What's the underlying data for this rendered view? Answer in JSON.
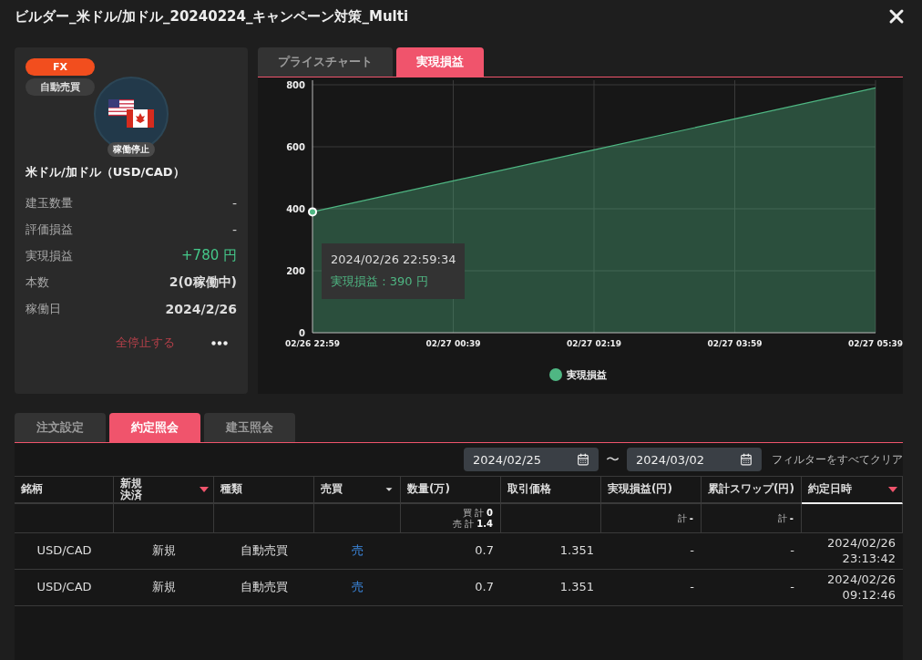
{
  "window": {
    "title": "ビルダー_米ドル/加ドル_20240224_キャンペーン対策_Multi"
  },
  "bot": {
    "badges": [
      {
        "label": "FX",
        "kind": "category"
      },
      {
        "label": "自動売買",
        "kind": "type"
      }
    ],
    "status": "稼働停止",
    "pair": "米ドル/加ドル（USD/CAD）",
    "stats": [
      {
        "label": "建玉数量",
        "value": "-",
        "kind": "plain"
      },
      {
        "label": "評価損益",
        "value": "-",
        "kind": "plain"
      },
      {
        "label": "実現損益",
        "value": "+780 円",
        "kind": "profit"
      },
      {
        "label": "本数",
        "value": "2(0稼働中)",
        "kind": "strong"
      },
      {
        "label": "稼働日",
        "value": "2024/2/26",
        "kind": "strong"
      }
    ],
    "stop_button": "全停止する"
  },
  "chart_tabs": [
    {
      "label": "プライスチャート",
      "selected": false
    },
    {
      "label": "実現損益",
      "selected": true
    }
  ],
  "chart": {
    "chart_data": {
      "type": "area",
      "categories": [
        "02/26 22:59",
        "02/27 00:39",
        "02/27 02:19",
        "02/27 03:59",
        "02/27 05:39"
      ],
      "series": [
        {
          "name": "実現損益",
          "color": "#4fb783",
          "values": [
            390,
            490,
            590,
            690,
            790
          ]
        }
      ],
      "ylim": [
        0,
        800
      ],
      "grid": true,
      "yticks": [
        0,
        200,
        400,
        600,
        800
      ]
    },
    "tooltip": {
      "time": "2024/02/26 22:59:34",
      "label": "実現損益 : 390 円"
    }
  },
  "tabs": [
    {
      "label": "注文設定",
      "selected": false
    },
    {
      "label": "約定照会",
      "selected": true
    },
    {
      "label": "建玉照会",
      "selected": false
    }
  ],
  "filter": {
    "date_from": "2024/02/25",
    "separator": "〜",
    "date_to": "2024/03/02",
    "clear": "フィルターをすべてクリア"
  },
  "table": {
    "columns": [
      {
        "label": "銘柄",
        "sorted": false,
        "filter": false,
        "selected": false
      },
      {
        "label": "新規決済",
        "sorted": true,
        "filter": false,
        "selected": false
      },
      {
        "label": "種類",
        "sorted": false,
        "filter": false,
        "selected": false
      },
      {
        "label": "売買",
        "sorted": false,
        "filter": true,
        "selected": false
      },
      {
        "label": "数量(万)",
        "sorted": false,
        "filter": false,
        "selected": false,
        "summary": [
          "買 計 **0**",
          "売 計 **1.4**"
        ]
      },
      {
        "label": "取引価格",
        "sorted": false,
        "filter": false,
        "selected": false
      },
      {
        "label": "実現損益(円)",
        "sorted": false,
        "filter": false,
        "selected": false,
        "summary": [
          "計 **-**"
        ]
      },
      {
        "label": "累計スワップ(円)",
        "sorted": false,
        "filter": false,
        "selected": false,
        "summary": [
          "計 **-**"
        ]
      },
      {
        "label": "約定日時",
        "sorted": true,
        "filter": false,
        "selected": true
      }
    ],
    "rows": [
      [
        "USD/CAD",
        "新規",
        "自動売買",
        "売",
        "0.7",
        "1.351",
        "-",
        "-",
        "2024/02/26\n23:13:42"
      ],
      [
        "USD/CAD",
        "新規",
        "自動売買",
        "売",
        "0.7",
        "1.351",
        "-",
        "-",
        "2024/02/26\n09:12:46"
      ]
    ]
  }
}
